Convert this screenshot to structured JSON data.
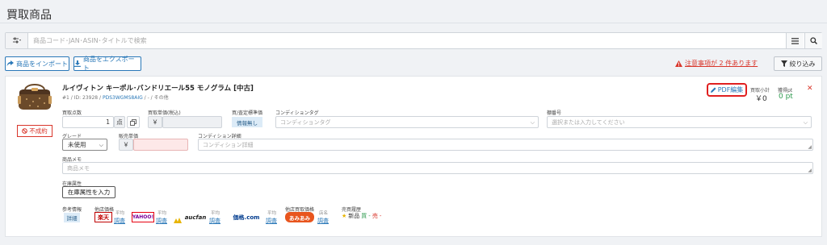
{
  "page": {
    "title": "買取商品"
  },
  "search": {
    "filter_icon": "sliders-icon",
    "placeholder": "商品コード･JAN･ASIN･タイトルで検索",
    "list_icon": "list-icon",
    "search_icon": "search-icon"
  },
  "toolbar": {
    "import_label": "商品をインポート",
    "export_label": "商品をエクスポート",
    "warning_text": "注意事項が 2 件あります",
    "filter_label": "絞り込み"
  },
  "item": {
    "image_icon": "handbag-icon",
    "status": "不成約",
    "title": "ルイヴィトン キーポル･バンドリエール55 モノグラム [中古]",
    "num": "#1",
    "id_text": "/ ID: 23928 /",
    "code": "PDS3WGMS8AIG",
    "id_tail": "/ - / その他",
    "pdf_label": "PDF編集",
    "subtotal_label": "買取小計",
    "subtotal_value": "￥0",
    "points_label": "獲得pt",
    "points_value": "0 pt",
    "fields": {
      "qty_label": "買取点数",
      "qty_value": "1",
      "qty_unit": "点",
      "price_label": "買取単価(税込)",
      "yen": "￥",
      "ref_label": "買/査定標準価",
      "ref_value": "情報無し",
      "cond_tag_label": "コンディションタグ",
      "cond_tag_placeholder": "コンディションタグ",
      "box_label": "棚番号",
      "box_placeholder": "選択または入力してください",
      "grade_label": "グレード",
      "grade_value": "未使用",
      "sale_label": "販売単価",
      "cond_detail_label": "コンディション詳細",
      "cond_detail_placeholder": "コンディション詳細",
      "memo_label": "商品メモ",
      "memo_placeholder": "商品メモ",
      "stock_label": "在庫属性",
      "stock_button": "在庫属性を入力"
    },
    "refs": {
      "ref_info_label": "参考情報",
      "detail": "詳細",
      "other_price_label": "他店価格",
      "rakuten": "楽天",
      "yahoo": "YAHOO!",
      "aucfan": "aucfan",
      "kakaku": "価格.com",
      "yoroshiku": "平均",
      "search_link": "調査",
      "other_buy_label": "他店買取価格",
      "mamama": "あみあみ",
      "kotei": "店名",
      "history_label": "売買履歴",
      "new_label": "新品",
      "buy": "買",
      "sell": "売",
      "dash": "-"
    }
  },
  "colors": {
    "accent": "#2a78b8",
    "danger": "#d9362b",
    "success": "#2e9b4f"
  }
}
